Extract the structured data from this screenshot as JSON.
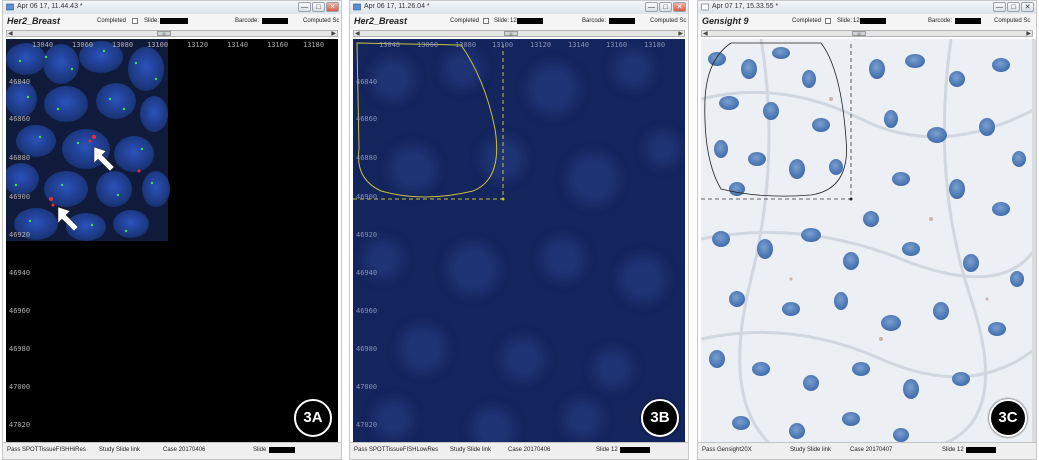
{
  "windows": [
    {
      "title": "Apr 06 17, 11.44.43 *",
      "heading": "Her2_Breast",
      "completed_label": "Completed",
      "slide_label": "Slide:",
      "slide_value": "",
      "barcode_label": "Barcode:",
      "computed_label": "Computed Sc",
      "x_ticks": [
        "13040",
        "13060",
        "13080",
        "13100",
        "13120",
        "13140",
        "13160",
        "13180"
      ],
      "y_ticks": [
        "46840",
        "46860",
        "46880",
        "46900",
        "46920",
        "46940",
        "46960",
        "46980",
        "47000",
        "47020"
      ],
      "status": {
        "pass": "Pass SPOTTissueFISHHiRes",
        "study": "Study Slide link",
        "case": "Case 20170406",
        "slide": "Slide"
      },
      "badge": "3A"
    },
    {
      "title": "Apr 06 17, 11.26.04 *",
      "heading": "Her2_Breast",
      "completed_label": "Completed",
      "slide_label": "Slide:",
      "slide_value": "12",
      "barcode_label": "Barcode:",
      "computed_label": "Computed Sc",
      "x_ticks": [
        "13040",
        "13060",
        "13080",
        "13100",
        "13120",
        "13140",
        "13160",
        "13180"
      ],
      "y_ticks": [
        "46840",
        "46860",
        "46880",
        "46900",
        "46920",
        "46940",
        "46960",
        "46980",
        "47000",
        "47020"
      ],
      "status": {
        "pass": "Pass SPOTTissueFISHLowRes",
        "study": "Study Slide link",
        "case": "Case 20170406",
        "slide": "Slide 12"
      },
      "badge": "3B"
    },
    {
      "title": "Apr 07 17, 15.33.55 *",
      "heading": "Gensight 9",
      "completed_label": "Completed",
      "slide_label": "Slide:",
      "slide_value": "12",
      "barcode_label": "Barcode:",
      "computed_label": "Computed Sc",
      "status": {
        "pass": "Pass Gensight20X",
        "study": "Study Slide link",
        "case": "Case 20170407",
        "slide": "Slide 12"
      },
      "badge": "3C"
    }
  ],
  "window_buttons": {
    "minimize": "—",
    "maximize": "□",
    "close": "✕"
  },
  "icons": [
    "window-icon",
    "arrow-left-icon",
    "arrow-right-icon",
    "pointer-arrow-icon"
  ],
  "colors": {
    "fluor_bg": "#000000",
    "fluor_nuclei": "#1f3f9a",
    "lowres_bg": "#13235a",
    "ihc_bg": "#e9edf2",
    "ihc_nuclei": "#4a76b4",
    "roi_yellow": "#c8c23a",
    "badge": "#000000"
  }
}
